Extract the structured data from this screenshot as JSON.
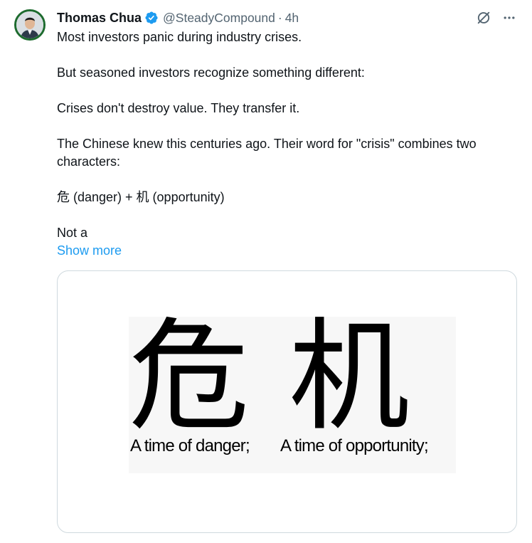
{
  "author": {
    "display_name": "Thomas Chua",
    "handle": "@SteadyCompound",
    "separator": "·",
    "time": "4h",
    "verified": true,
    "avatar_icon": "user-photo-avatar"
  },
  "actions": {
    "grok_icon": "grok-icon",
    "more_icon": "more-horizontal-icon"
  },
  "tweet": {
    "paragraphs": [
      "Most investors panic during industry crises.",
      "But seasoned investors recognize something different:",
      "Crises don't destroy value. They transfer it.",
      "The Chinese knew this centuries ago. Their word for \"crisis\" combines two characters:",
      "危 (danger) + 机 (opportunity)",
      "Not a"
    ],
    "show_more": "Show more"
  },
  "media": {
    "characters": [
      "危",
      "机"
    ],
    "captions": [
      "A time of danger;",
      "A time of opportunity;"
    ]
  },
  "colors": {
    "link": "#1d9bf0",
    "secondary_text": "#536471",
    "primary_text": "#0f1419",
    "verified_badge": "#1d9bf0",
    "avatar_ring": "#1d6b2e",
    "card_border": "#cfd9de"
  }
}
